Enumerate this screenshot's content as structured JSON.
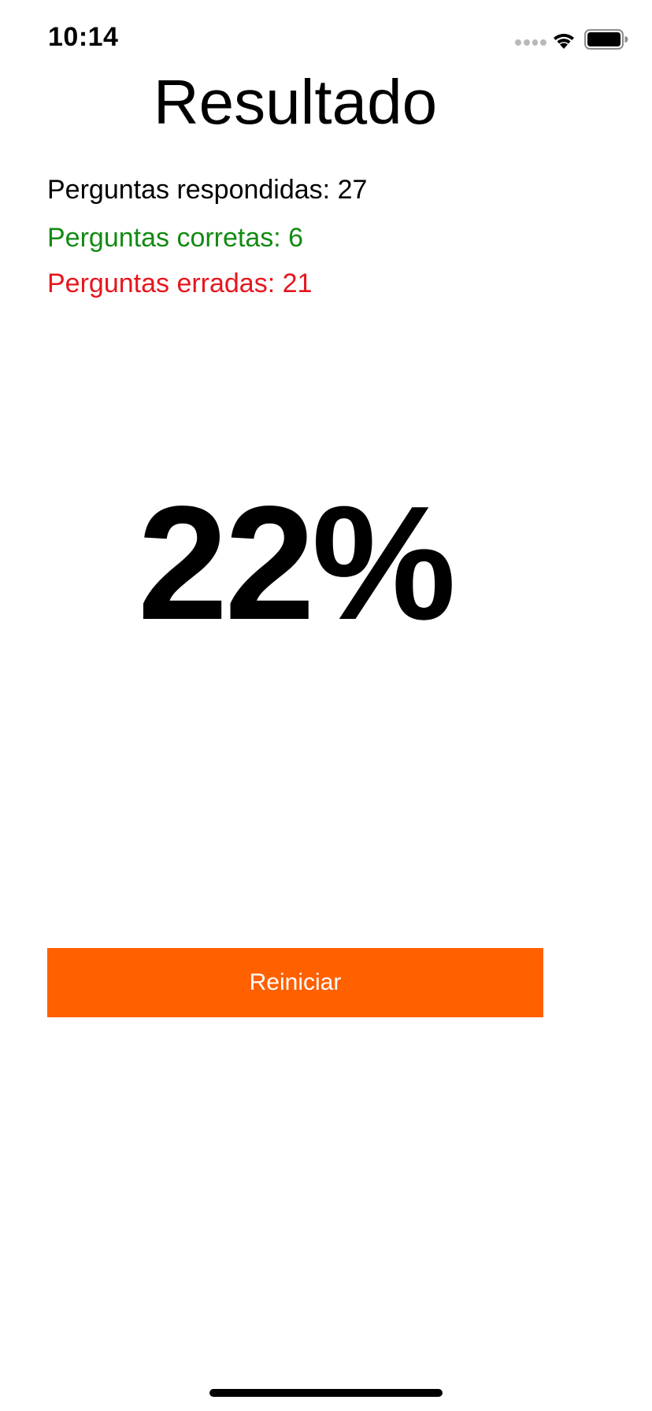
{
  "status_bar": {
    "time": "10:14",
    "icons": [
      "signal-dots-icon",
      "wifi-icon",
      "battery-icon"
    ]
  },
  "title": "Resultado",
  "stats": {
    "answered_label": "Perguntas respondidas: 27",
    "correct_label": "Perguntas corretas: 6",
    "wrong_label": "Perguntas erradas: 21"
  },
  "score": {
    "percent_label": "22%"
  },
  "actions": {
    "restart_label": "Reiniciar"
  },
  "colors": {
    "correct": "#138a13",
    "wrong": "#e6161e",
    "button_background": "#ff6000",
    "button_text": "#ffffff"
  }
}
